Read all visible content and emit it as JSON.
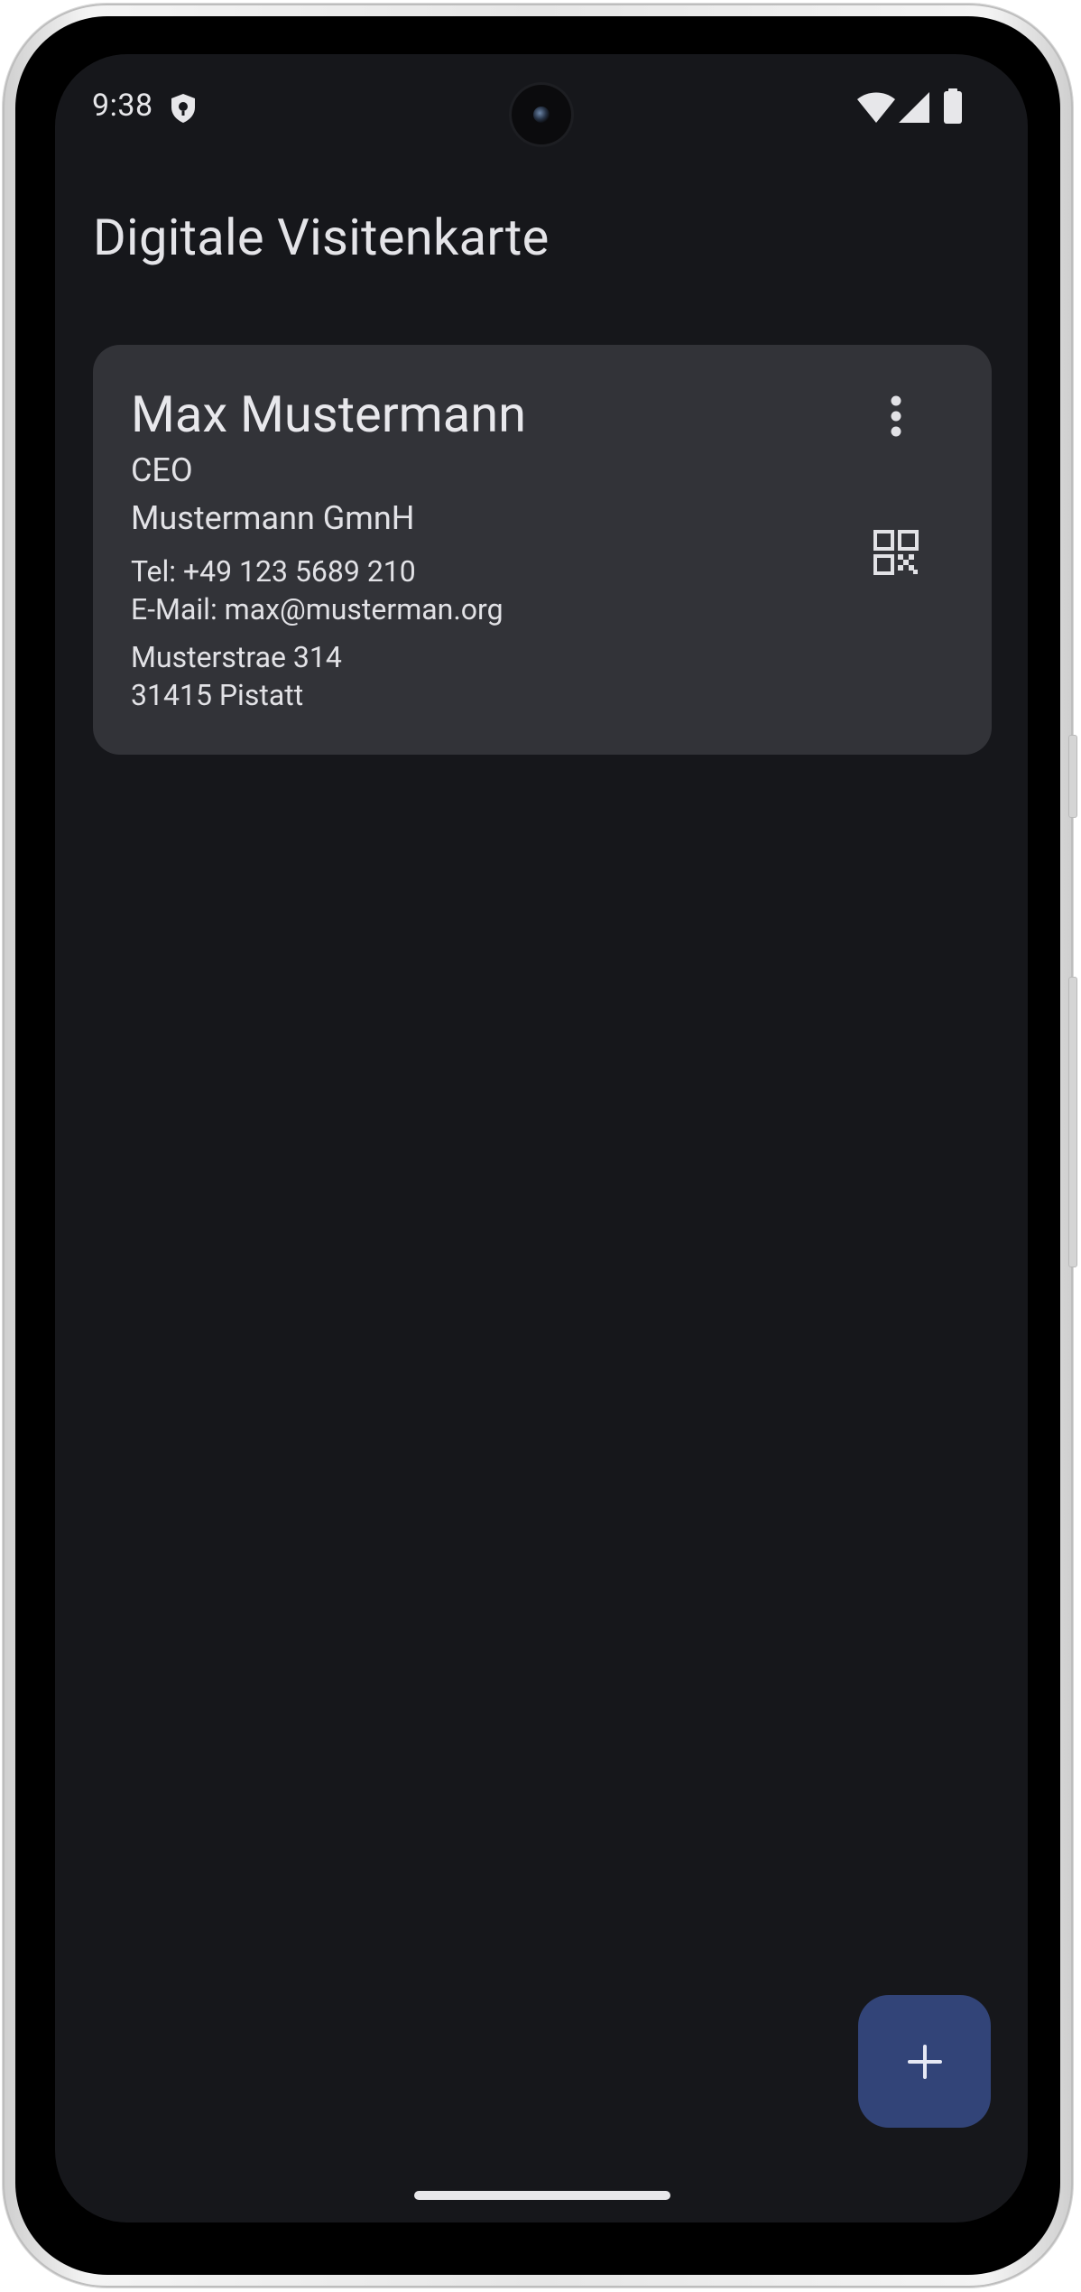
{
  "status_bar": {
    "time": "9:38"
  },
  "app_bar": {
    "title": "Digitale Visitenkarte"
  },
  "card": {
    "name": "Max Mustermann",
    "role": "CEO",
    "company": "Mustermann GmnH",
    "tel": "Tel: +49 123 5689 210",
    "email": "E-Mail: max@musterman.org",
    "street": "Musterstrae 314",
    "city": "31415 Pistatt",
    "more_icon": "more-vert-icon",
    "qr_icon": "qr-code-icon"
  },
  "fab": {
    "icon": "add-icon"
  },
  "colors": {
    "background": "#16171b",
    "card": "#323338",
    "fab": "#324478",
    "text": "#e2e2e6"
  }
}
